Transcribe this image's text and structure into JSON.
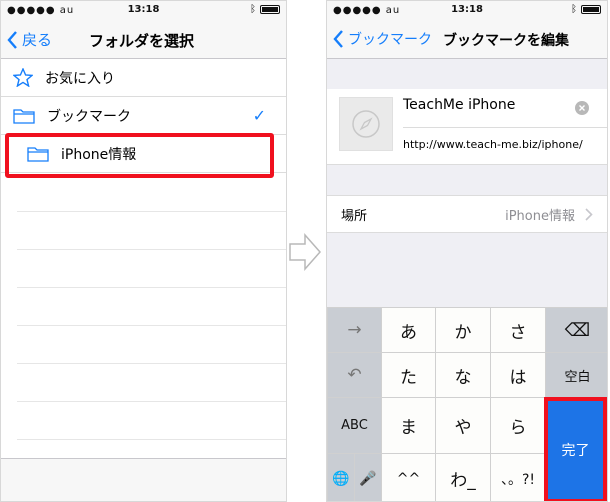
{
  "status": {
    "carrier": "●●●●● au",
    "time": "13:18"
  },
  "left": {
    "back_label": "戻る",
    "title": "フォルダを選択",
    "items": [
      {
        "label": "お気に入り"
      },
      {
        "label": "ブックマーク"
      },
      {
        "label": "iPhone情報"
      }
    ],
    "check": "✓"
  },
  "right": {
    "back_label": "ブックマーク",
    "title": "ブックマークを編集",
    "bookmark_title": "TeachMe iPhone",
    "bookmark_url": "http://www.teach-me.biz/iphone/",
    "location_label": "場所",
    "location_value": "iPhone情報"
  },
  "keyboard": {
    "row1": [
      "→",
      "あ",
      "か",
      "さ",
      "⌫"
    ],
    "row2": [
      "↶",
      "た",
      "な",
      "は",
      "空白"
    ],
    "row3": [
      "ABC",
      "ま",
      "や",
      "ら"
    ],
    "row4": [
      "🌐",
      "🎤",
      "^^",
      "わ_",
      "、。?!"
    ],
    "done": "完了"
  }
}
